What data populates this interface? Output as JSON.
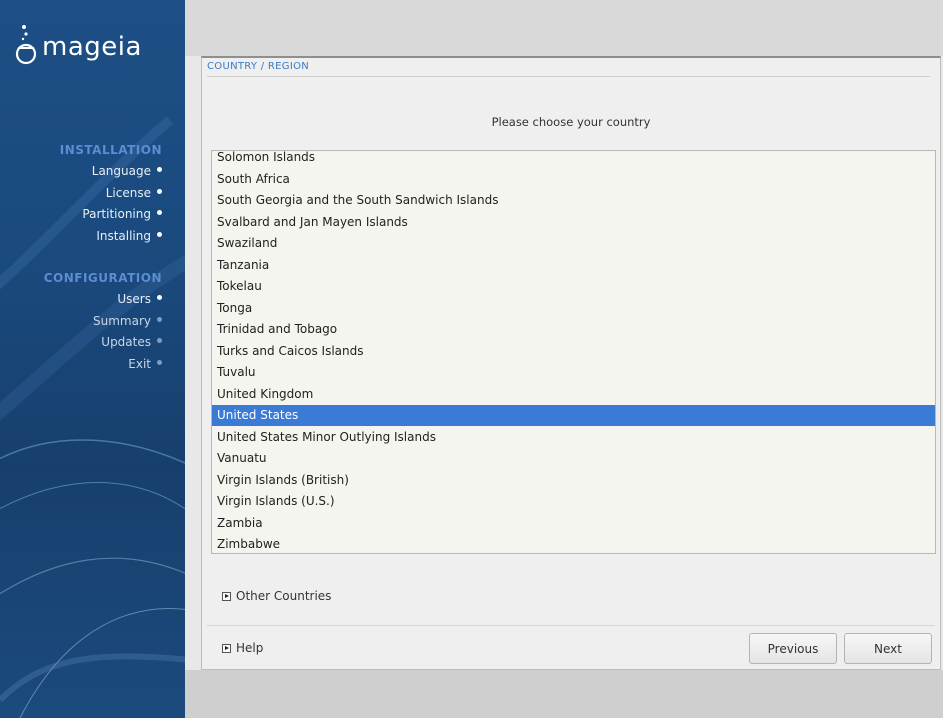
{
  "sidebar": {
    "brand": "mageia",
    "sections": [
      {
        "title": "INSTALLATION",
        "items": [
          {
            "label": "Language",
            "state": "done"
          },
          {
            "label": "License",
            "state": "done"
          },
          {
            "label": "Partitioning",
            "state": "done"
          },
          {
            "label": "Installing",
            "state": "done"
          }
        ]
      },
      {
        "title": "CONFIGURATION",
        "items": [
          {
            "label": "Users",
            "state": "done"
          },
          {
            "label": "Summary",
            "state": "pending"
          },
          {
            "label": "Updates",
            "state": "pending"
          },
          {
            "label": "Exit",
            "state": "pending"
          }
        ]
      }
    ]
  },
  "panel": {
    "title": "COUNTRY / REGION",
    "prompt": "Please choose your country",
    "countries": [
      "Solomon Islands",
      "South Africa",
      "South Georgia and the South Sandwich Islands",
      "Svalbard and Jan Mayen Islands",
      "Swaziland",
      "Tanzania",
      "Tokelau",
      "Tonga",
      "Trinidad and Tobago",
      "Turks and Caicos Islands",
      "Tuvalu",
      "United Kingdom",
      "United States",
      "United States Minor Outlying Islands",
      "Vanuatu",
      "Virgin Islands (British)",
      "Virgin Islands (U.S.)",
      "Zambia",
      "Zimbabwe"
    ],
    "selected_country": "United States",
    "other_countries_label": "Other Countries",
    "help_label": "Help",
    "previous_label": "Previous",
    "next_label": "Next"
  },
  "colors": {
    "sidebar_bg": "#1b4a7d",
    "section_title": "#5b8dd0",
    "selection": "#3a7bd5",
    "panel_title": "#3a7ac8"
  }
}
